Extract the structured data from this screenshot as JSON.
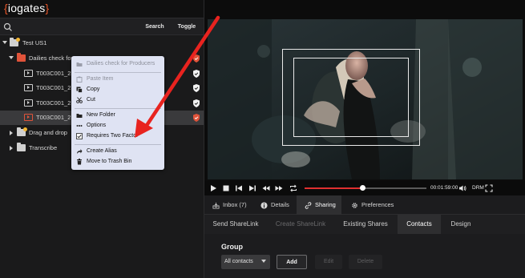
{
  "logo": {
    "brace_open": "{",
    "text": "iogates",
    "brace_close": "}"
  },
  "search": {
    "placeholder": "",
    "search_label": "Search",
    "toggle_label": "Toggle"
  },
  "tree": [
    {
      "label": "Test US1",
      "type": "project",
      "expanded": true
    },
    {
      "label": "Dailies check for",
      "type": "folder-red",
      "expanded": true,
      "status": "shield-red"
    },
    {
      "label": "T003C001_23",
      "type": "video",
      "status": "shield-white"
    },
    {
      "label": "T003C001_23",
      "type": "video",
      "status": "shield-white"
    },
    {
      "label": "T003C001_23",
      "type": "video",
      "status": "shield-white"
    },
    {
      "label": "T003C001_23",
      "type": "video-red",
      "selected": true,
      "status": "shield-red"
    },
    {
      "label": "Drag and drop",
      "type": "folder",
      "expanded": false
    },
    {
      "label": "Transcribe",
      "type": "folder",
      "expanded": false
    }
  ],
  "context_menu": {
    "items": [
      {
        "label": "Dailies check for Producers",
        "icon": "folder-icon",
        "disabled": true
      },
      {
        "label": "Paste Item",
        "icon": "paste-icon",
        "disabled": true
      },
      {
        "label": "Copy",
        "icon": "copy-icon"
      },
      {
        "label": "Cut",
        "icon": "scissors-icon"
      },
      {
        "label": "New Folder",
        "icon": "new-folder-icon"
      },
      {
        "label": "Options",
        "icon": "dots-icon"
      },
      {
        "label": "Requires Two Factor",
        "icon": "checkbox-checked-icon"
      },
      {
        "label": "Create Alias",
        "icon": "alias-arrow-icon"
      },
      {
        "label": "Move to Trash Bin",
        "icon": "trash-icon"
      }
    ]
  },
  "player": {
    "timecode": "00:01:59:00",
    "drm_label": "DRM",
    "progress": 0.48
  },
  "tabs": [
    {
      "label": "Inbox (7)",
      "icon": "inbox-icon"
    },
    {
      "label": "Details",
      "icon": "info-icon"
    },
    {
      "label": "Sharing",
      "icon": "link-icon",
      "active": true
    },
    {
      "label": "Preferences",
      "icon": "gear-icon"
    }
  ],
  "subtabs": [
    {
      "label": "Send ShareLink"
    },
    {
      "label": "Create ShareLink",
      "disabled": true
    },
    {
      "label": "Existing Shares"
    },
    {
      "label": "Contacts",
      "active": true
    },
    {
      "label": "Design"
    }
  ],
  "group": {
    "title": "Group",
    "select_value": "All contacts",
    "add_label": "Add",
    "edit_label": "Edit",
    "delete_label": "Delete"
  },
  "colors": {
    "accent_red": "#e0533a",
    "annotation_arrow": "#e8231f",
    "menu_bg": "#dfe3f3"
  }
}
